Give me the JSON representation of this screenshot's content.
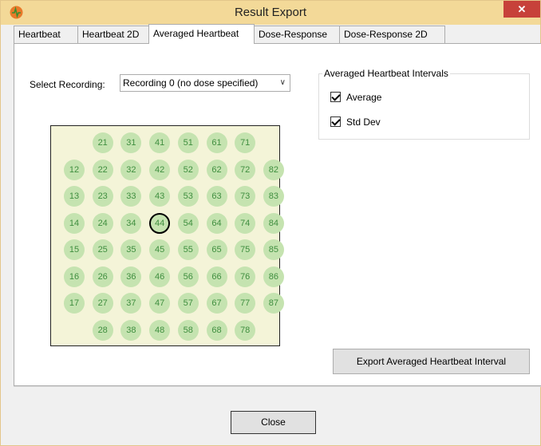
{
  "window": {
    "title": "Result Export",
    "close_glyph": "✕"
  },
  "tabs": [
    {
      "label": "Heartbeat",
      "active": false
    },
    {
      "label": "Heartbeat 2D",
      "active": false
    },
    {
      "label": "Averaged Heartbeat",
      "active": true
    },
    {
      "label": "Dose-Response",
      "active": false
    },
    {
      "label": "Dose-Response 2D",
      "active": false
    }
  ],
  "recording": {
    "label": "Select Recording:",
    "selected": "Recording 0 (no dose specified)",
    "dropdown_icon": "chevron-down-icon"
  },
  "intervals_group": {
    "title": "Averaged Heartbeat Intervals",
    "options": [
      {
        "label": "Average",
        "checked": true
      },
      {
        "label": "Std Dev",
        "checked": true
      }
    ]
  },
  "plate": {
    "rows": [
      [
        "",
        "21",
        "31",
        "41",
        "51",
        "61",
        "71",
        ""
      ],
      [
        "12",
        "22",
        "32",
        "42",
        "52",
        "62",
        "72",
        "82"
      ],
      [
        "13",
        "23",
        "33",
        "43",
        "53",
        "63",
        "73",
        "83"
      ],
      [
        "14",
        "24",
        "34",
        "44",
        "54",
        "64",
        "74",
        "84"
      ],
      [
        "15",
        "25",
        "35",
        "45",
        "55",
        "65",
        "75",
        "85"
      ],
      [
        "16",
        "26",
        "36",
        "46",
        "56",
        "66",
        "76",
        "86"
      ],
      [
        "17",
        "27",
        "37",
        "47",
        "57",
        "67",
        "77",
        "87"
      ],
      [
        "",
        "28",
        "38",
        "48",
        "58",
        "68",
        "78",
        ""
      ]
    ],
    "selected_well": "44",
    "well_color": "#c5e3b0",
    "well_text_color": "#3f8e3f"
  },
  "buttons": {
    "export_label": "Export Averaged Heartbeat Interval",
    "close_label": "Close"
  },
  "colors": {
    "titlebar": "#f3d998",
    "close_button": "#c7413a"
  }
}
